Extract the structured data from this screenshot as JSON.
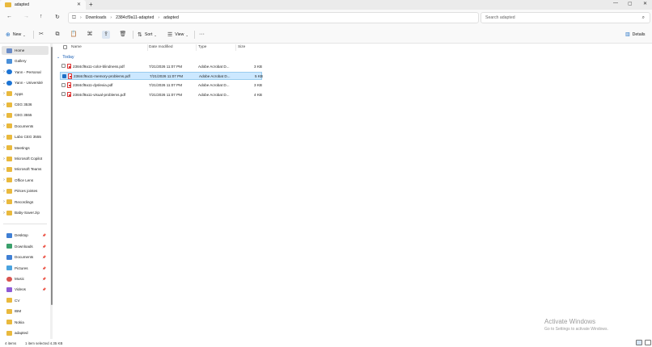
{
  "tab": {
    "title": "adapted",
    "close": "✕",
    "new": "+"
  },
  "window": {
    "minimize": "—",
    "maximize": "▢",
    "close": "✕"
  },
  "nav": {
    "back": "←",
    "forward": "→",
    "up": "↑",
    "refresh": "↻",
    "pc": "🖵",
    "chevron": "›"
  },
  "breadcrumb": [
    "Downloads",
    "2384cf9a11-adapted",
    "adapted"
  ],
  "search": {
    "placeholder": "Search adapted",
    "icon": "⌕"
  },
  "toolbar": {
    "new_label": "New",
    "sort_label": "Sort",
    "view_label": "View",
    "more_label": "···",
    "details_label": "Details"
  },
  "sidebar": {
    "items": [
      {
        "label": "Home",
        "icon": "home",
        "selected": true
      },
      {
        "label": "Gallery",
        "icon": "gallery"
      },
      {
        "label": "Yann - Personal",
        "icon": "cloud",
        "chev": "›"
      },
      {
        "label": "Yann - Université",
        "icon": "cloud",
        "chev": "⌄"
      },
      {
        "label": "Apps",
        "icon": "folder",
        "chev": "›"
      },
      {
        "label": "CEG 3536",
        "icon": "folder",
        "chev": "›"
      },
      {
        "label": "CEG 3555",
        "icon": "folder",
        "chev": "›"
      },
      {
        "label": "Documents",
        "icon": "folder",
        "chev": "›"
      },
      {
        "label": "Labo CEG 3555",
        "icon": "folder",
        "chev": "›"
      },
      {
        "label": "Meetings",
        "icon": "folder",
        "chev": "›"
      },
      {
        "label": "Microsoft Copilot",
        "icon": "folder",
        "chev": "›"
      },
      {
        "label": "Microsoft Teams",
        "icon": "folder",
        "chev": "›"
      },
      {
        "label": "Office Lens",
        "icon": "folder",
        "chev": "›"
      },
      {
        "label": "Pièces jointes",
        "icon": "folder",
        "chev": "›"
      },
      {
        "label": "Recordings",
        "icon": "folder",
        "chev": "›"
      },
      {
        "label": "Baby-Saver.zip",
        "icon": "folder",
        "chev": "›"
      }
    ],
    "quick": [
      {
        "label": "Desktop",
        "icon": "blue",
        "pinned": true
      },
      {
        "label": "Downloads",
        "icon": "green",
        "pinned": true
      },
      {
        "label": "Documents",
        "icon": "blue",
        "pinned": true
      },
      {
        "label": "Pictures",
        "icon": "pics",
        "pinned": true
      },
      {
        "label": "Music",
        "icon": "red",
        "pinned": true
      },
      {
        "label": "Videos",
        "icon": "purple",
        "pinned": true
      },
      {
        "label": "CV",
        "icon": "folder"
      },
      {
        "label": "IBM",
        "icon": "folder"
      },
      {
        "label": "Nokia",
        "icon": "folder"
      },
      {
        "label": "adapted",
        "icon": "folder"
      }
    ],
    "pin_glyph": "📌"
  },
  "columns": {
    "name": "Name",
    "date": "Date modified",
    "type": "Type",
    "size": "Size"
  },
  "group": {
    "label": "Today",
    "chev": "⌄"
  },
  "files": [
    {
      "name": "2384cf9a11-color-blindness.pdf",
      "date": "7/21/2026 11:07 PM",
      "type": "Adobe Acrobat D...",
      "size": "3 KB",
      "selected": false
    },
    {
      "name": "2384cf9a11-memory-problems.pdf",
      "date": "7/21/2026 11:07 PM",
      "type": "Adobe Acrobat D...",
      "size": "5 KB",
      "selected": true
    },
    {
      "name": "2384cf9a11-dyslexia.pdf",
      "date": "7/21/2026 11:07 PM",
      "type": "Adobe Acrobat D...",
      "size": "3 KB",
      "selected": false
    },
    {
      "name": "2384cf9a11-visual-problems.pdf",
      "date": "7/21/2026 11:07 PM",
      "type": "Adobe Acrobat D...",
      "size": "4 KB",
      "selected": false
    }
  ],
  "watermark": {
    "title": "Activate Windows",
    "subtitle": "Go to Settings to activate Windows."
  },
  "status": {
    "items": "4 items",
    "selected": "1 item selected  4.35 KB"
  }
}
